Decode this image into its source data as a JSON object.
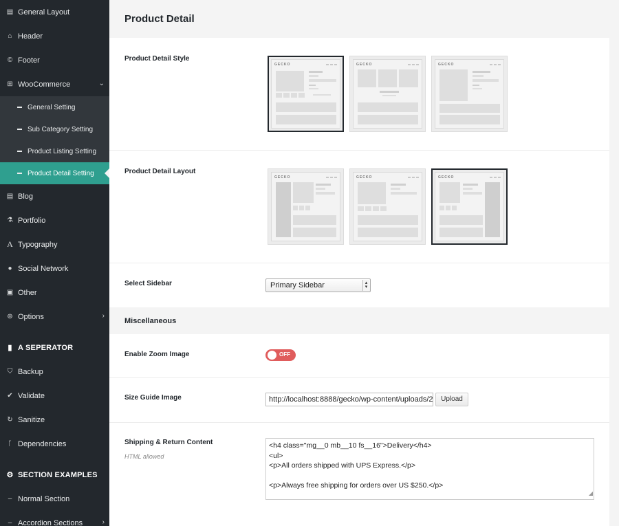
{
  "sidebar": {
    "items": [
      {
        "label": "General Layout",
        "icon": "document-icon"
      },
      {
        "label": "Header",
        "icon": "home-icon"
      },
      {
        "label": "Footer",
        "icon": "copyright-icon"
      },
      {
        "label": "WooCommerce",
        "icon": "cart-icon"
      }
    ],
    "woocommerce_sub": [
      {
        "label": "General Setting"
      },
      {
        "label": "Sub Category Setting"
      },
      {
        "label": "Product Listing Setting"
      },
      {
        "label": "Product Detail Setting"
      }
    ],
    "items2": [
      {
        "label": "Blog",
        "icon": "document-icon"
      },
      {
        "label": "Portfolio",
        "icon": "flask-icon"
      },
      {
        "label": "Typography",
        "icon": "font-icon"
      },
      {
        "label": "Social Network",
        "icon": "globe-icon"
      },
      {
        "label": "Other",
        "icon": "gift-icon"
      },
      {
        "label": "Options",
        "icon": "plus-circle-icon"
      }
    ],
    "separator": "A SEPERATOR",
    "items3": [
      {
        "label": "Backup",
        "icon": "shield-icon"
      },
      {
        "label": "Validate",
        "icon": "check-circle-icon"
      },
      {
        "label": "Sanitize",
        "icon": "refresh-icon"
      },
      {
        "label": "Dependencies",
        "icon": "code-branch-icon"
      }
    ],
    "section_examples": "SECTION EXAMPLES",
    "items4": [
      {
        "label": "Normal Section",
        "icon": "dash-icon"
      },
      {
        "label": "Accordion Sections",
        "icon": "dash-icon"
      }
    ]
  },
  "page": {
    "title": "Product Detail"
  },
  "fields": {
    "style_label": "Product Detail Style",
    "layout_label": "Product Detail Layout",
    "sidebar_label": "Select Sidebar",
    "sidebar_value": "Primary Sidebar",
    "misc_label": "Miscellaneous",
    "zoom_label": "Enable Zoom Image",
    "zoom_state": "OFF",
    "size_guide_label": "Size Guide Image",
    "size_guide_value": "http://localhost:8888/gecko/wp-content/uploads/2",
    "upload_label": "Upload",
    "shipping_label": "Shipping & Return Content",
    "shipping_hint": "HTML allowed",
    "shipping_lines": [
      "<h4 class=\"mg__0 mb__10 fs__16\">Delivery</h4>",
      "<ul>",
      "<p>All orders shipped with UPS Express.</p>",
      "",
      "<p>Always free shipping for orders over US $250.</p>"
    ]
  },
  "thumb_logo": "GECKO",
  "colors": {
    "sidebar_bg": "#23282d",
    "active_item": "#2f9f8f",
    "toggle_off": "#e05c5c"
  }
}
